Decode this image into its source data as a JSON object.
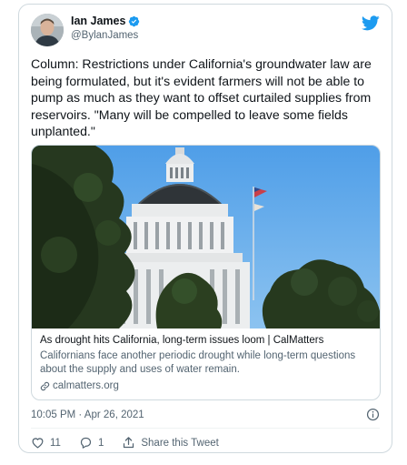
{
  "author": {
    "name": "Ian James",
    "handle": "@BylanJames"
  },
  "tweet": {
    "text": "Column: Restrictions under California's groundwater law are being formulated, but it's evident farmers will not be able to pump as much as they want to offset curtailed supplies from reservoirs. \"Many will be compelled to leave some fields unplanted.\"",
    "timestamp": "10:05 PM · Apr 26, 2021"
  },
  "link_card": {
    "title": "As drought hits California, long-term issues loom | CalMatters",
    "description": "Californians face another periodic drought while long-term questions about the supply and uses of water remain.",
    "domain": "calmatters.org"
  },
  "actions": {
    "like_count": "11",
    "reply_count": "1",
    "share_label": "Share this Tweet"
  },
  "colors": {
    "brand": "#1d9bf0",
    "text_primary": "#0f1419",
    "text_secondary": "#536471",
    "border": "#cfd9de"
  },
  "icons": [
    "verified-badge-icon",
    "twitter-bird-icon",
    "link-icon",
    "info-icon",
    "heart-icon",
    "reply-icon",
    "share-icon"
  ]
}
